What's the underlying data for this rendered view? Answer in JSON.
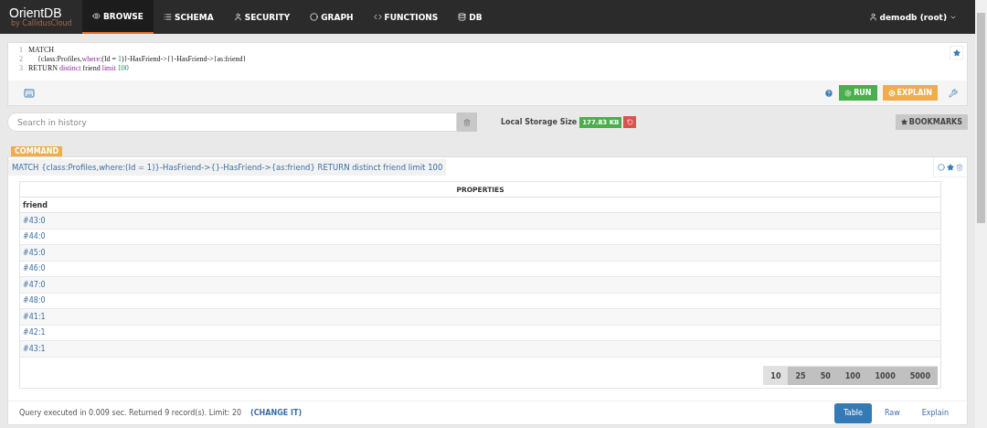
{
  "logo": {
    "name": "OrientDB",
    "tagline": "by CallidusCloud"
  },
  "nav": [
    {
      "label": "BROWSE",
      "selected": true
    },
    {
      "label": "SCHEMA",
      "selected": false
    },
    {
      "label": "SECURITY",
      "selected": false
    },
    {
      "label": "GRAPH",
      "selected": false
    },
    {
      "label": "FUNCTIONS",
      "selected": false
    },
    {
      "label": "DB",
      "selected": false
    }
  ],
  "user_menu": "demodb (root)",
  "editor": {
    "lines": [
      {
        "number": "1",
        "tokens": [
          {
            "text": "MATCH",
            "kind": "plain"
          }
        ]
      },
      {
        "number": "2",
        "tokens": [
          {
            "text": "     {class:Profiles,",
            "kind": "plain"
          },
          {
            "text": "where",
            "kind": "keyword"
          },
          {
            "text": ":(Id = ",
            "kind": "plain"
          },
          {
            "text": "1",
            "kind": "number"
          },
          {
            "text": ")}-HasFriend->{}-HasFriend->{as:friend}",
            "kind": "plain"
          }
        ]
      },
      {
        "number": "3",
        "tokens": [
          {
            "text": "RETURN ",
            "kind": "plain"
          },
          {
            "text": "distinct",
            "kind": "keyword"
          },
          {
            "text": " friend ",
            "kind": "plain"
          },
          {
            "text": "limit",
            "kind": "keyword"
          },
          {
            "text": " 100",
            "kind": "number"
          }
        ]
      }
    ],
    "run": "RUN",
    "explain": "EXPLAIN"
  },
  "history": {
    "placeholder": "Search in history",
    "storage_label": "Local Storage Size",
    "storage_value": "177.83 KB",
    "bookmarks": "BOOKMARKS"
  },
  "command": {
    "badge": "COMMAND",
    "query": "MATCH {class:Profiles,where:(Id = 1)}-HasFriend->{}-HasFriend->{as:friend} RETURN distinct friend limit 100",
    "table": {
      "group_header": "PROPERTIES",
      "columns": [
        "friend"
      ],
      "rows": [
        [
          "#43:0"
        ],
        [
          "#44:0"
        ],
        [
          "#45:0"
        ],
        [
          "#46:0"
        ],
        [
          "#47:0"
        ],
        [
          "#48:0"
        ],
        [
          "#41:1"
        ],
        [
          "#42:1"
        ],
        [
          "#43:1"
        ]
      ]
    },
    "page_sizes": [
      {
        "label": "10",
        "selected": true
      },
      {
        "label": "25",
        "selected": false
      },
      {
        "label": "50",
        "selected": false
      },
      {
        "label": "100",
        "selected": false
      },
      {
        "label": "1000",
        "selected": false
      },
      {
        "label": "5000",
        "selected": false
      }
    ],
    "status": "Query executed in 0.009 sec. Returned 9 record(s). Limit: 20",
    "change_link": "(CHANGE IT)",
    "views": [
      {
        "label": "Table",
        "selected": true
      },
      {
        "label": "Raw",
        "selected": false
      },
      {
        "label": "Explain",
        "selected": false
      }
    ]
  }
}
